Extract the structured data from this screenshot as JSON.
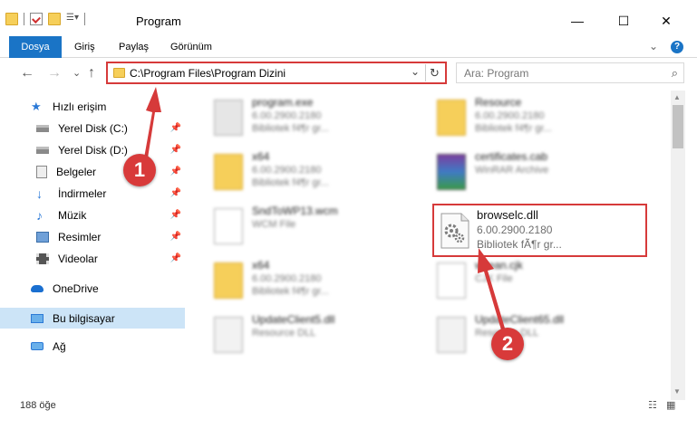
{
  "window": {
    "title": "Program",
    "minimize": "—",
    "maximize": "☐",
    "close": "✕"
  },
  "ribbon": {
    "tabs": [
      "Dosya",
      "Giriş",
      "Paylaş",
      "Görünüm"
    ],
    "help_icon": "?",
    "expand_icon": "⌄"
  },
  "nav": {
    "back": "←",
    "forward": "→",
    "recent": "⌄",
    "up": "↑",
    "address": "C:\\Program Files\\Program Dizini",
    "address_dropdown": "⌄",
    "refresh": "↻",
    "search_placeholder": "Ara: Program",
    "search_icon": "⌕"
  },
  "sidebar": {
    "items": [
      {
        "label": "Hızlı erişim",
        "icon": "star-icon",
        "color": "#2b79d6",
        "pinned": false
      },
      {
        "label": "Yerel Disk (C:)",
        "icon": "drive-icon",
        "color": "#6a6a6a",
        "pinned": true
      },
      {
        "label": "Yerel Disk (D:)",
        "icon": "drive-icon",
        "color": "#6a6a6a",
        "pinned": true
      },
      {
        "label": "Belgeler",
        "icon": "documents-icon",
        "color": "#8a8a8a",
        "pinned": true
      },
      {
        "label": "İndirmeler",
        "icon": "download-icon",
        "color": "#2b79d6",
        "pinned": true
      },
      {
        "label": "Müzik",
        "icon": "music-icon",
        "color": "#2b79d6",
        "pinned": true
      },
      {
        "label": "Resimler",
        "icon": "pictures-icon",
        "color": "#3a6ea8",
        "pinned": true
      },
      {
        "label": "Videolar",
        "icon": "videos-icon",
        "color": "#555555",
        "pinned": true
      },
      {
        "label": "OneDrive",
        "icon": "cloud-icon",
        "color": "#1a6fd0",
        "pinned": false
      },
      {
        "label": "Bu bilgisayar",
        "icon": "computer-icon",
        "color": "#2b79d6",
        "pinned": false
      },
      {
        "label": "Ağ",
        "icon": "network-icon",
        "color": "#2b79d6",
        "pinned": false
      }
    ],
    "pin_glyph": "📌"
  },
  "files": [
    {
      "name": "program.exe",
      "line1": "6.00.2900.2180",
      "line2": "Bibliotek f4¶r gr...",
      "icon": "exe-icon"
    },
    {
      "name": "Resource",
      "line1": "6.00.2900.2180",
      "line2": "Bibliotek f4¶r gr...",
      "icon": "folder-icon"
    },
    {
      "name": "x64",
      "line1": "6.00.2900.2180",
      "line2": "Bibliotek f4¶r gr...",
      "icon": "folder-icon"
    },
    {
      "name": "certificates.cab",
      "line1": "WinRAR Archive",
      "line2": "",
      "icon": "archive-icon"
    },
    {
      "name": "SndToWP13.wcm",
      "line1": "WCM File",
      "line2": "",
      "icon": "file-icon"
    },
    {
      "name": "x64",
      "line1": "6.00.2900.2180",
      "line2": "Bibliotek f4¶r gr...",
      "icon": "folder-icon"
    },
    {
      "name": "wkean.cjk",
      "line1": "CJK File",
      "line2": "",
      "icon": "file-icon"
    },
    {
      "name": "UpdateClient5.dll",
      "line1": "Resource DLL",
      "line2": "",
      "icon": "dll-icon"
    },
    {
      "name": "UpdateClient65.dll",
      "line1": "Resource DLL",
      "line2": "",
      "icon": "dll-icon"
    }
  ],
  "highlighted_file": {
    "name": "browselc.dll",
    "line1": "6.00.2900.2180",
    "line2": "Bibliotek fÃ¶r gr..."
  },
  "annotations": {
    "step1": "1",
    "step2": "2",
    "color": "#d63a3a"
  },
  "status": {
    "count": "188 öğe"
  }
}
